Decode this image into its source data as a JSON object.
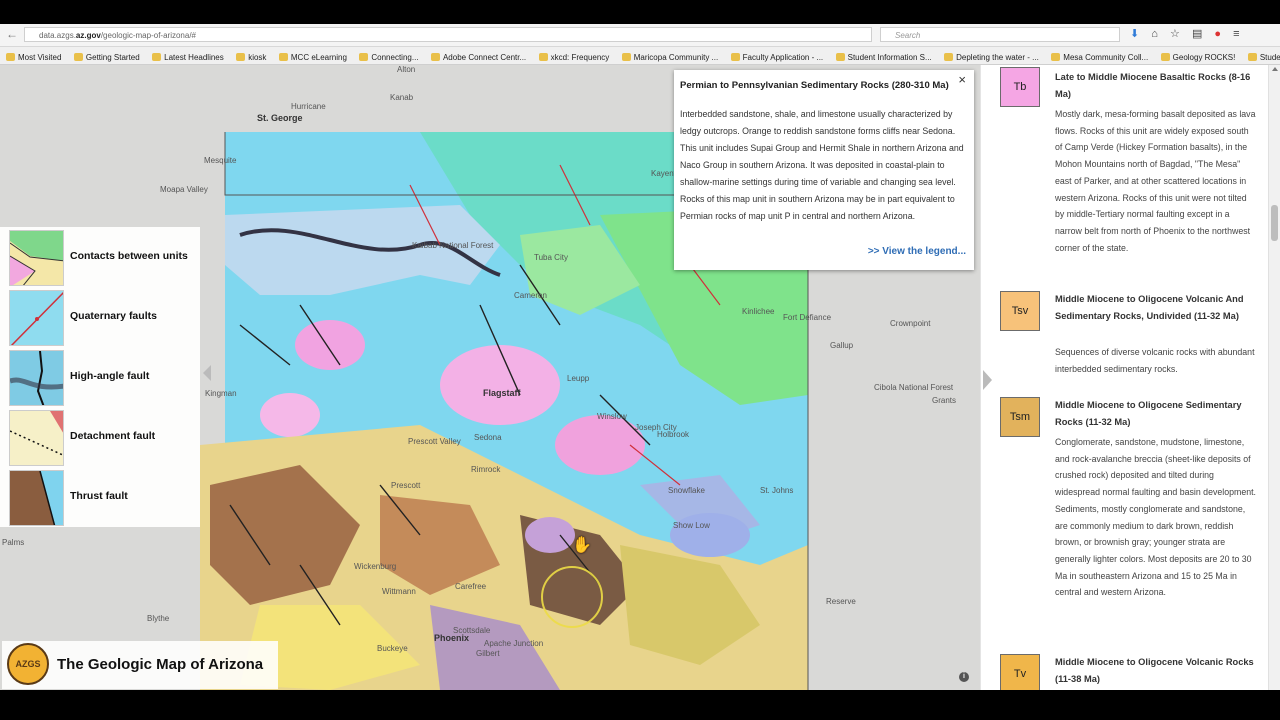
{
  "browser": {
    "url_prefix": "data.azgs.",
    "url_host": "az.gov",
    "url_path": "/geologic-map-of-arizona/#",
    "search_placeholder": "Search",
    "toolbar_icons": [
      "download-icon",
      "home-icon",
      "star-icon",
      "menu-icon",
      "profile-icon",
      "hamburger-icon"
    ]
  },
  "bookmarks": [
    "Most Visited",
    "Getting Started",
    "Latest Headlines",
    "kiosk",
    "MCC eLearning",
    "Connecting...",
    "Adobe Connect Centr...",
    "xkcd: Frequency",
    "Maricopa Community ...",
    "Faculty Application - ...",
    "Student Information S...",
    "Depleting the water - ...",
    "Mesa Community Coll...",
    "Geology ROCKS!",
    "Student Information S..."
  ],
  "legend": {
    "items": [
      {
        "label": "Contacts between units"
      },
      {
        "label": "Quaternary faults"
      },
      {
        "label": "High-angle fault"
      },
      {
        "label": "Detachment fault"
      },
      {
        "label": "Thrust fault"
      }
    ]
  },
  "popup": {
    "title": "Permian to Pennsylvanian Sedimentary Rocks (280-310 Ma)",
    "close": "×",
    "body": "Interbedded sandstone, shale, and limestone usually characterized by ledgy outcrops. Orange to reddish sandstone forms cliffs near Sedona. This unit includes Supai Group and Hermit Shale in northern Arizona and Naco Group in southern Arizona. It was deposited in coastal-plain to shallow-marine settings during time of variable and changing sea level. Rocks of this map unit in southern Arizona may be in part equivalent to Permian rocks of map unit P in central and northern Arizona.",
    "link": ">> View the legend..."
  },
  "map": {
    "title": "The Geologic Map of Arizona",
    "logo_text": "AZGS",
    "info": "i",
    "places": [
      "Alton",
      "St. George",
      "Kanab",
      "Hurricane",
      "Mesquite",
      "Moapa Valley",
      "Tuba City",
      "Cameron",
      "Kayenta",
      "Kinlichee",
      "Fort Defiance",
      "Crownpoint",
      "Gallup",
      "Leupp",
      "Winslow",
      "Flagstaff",
      "Sedona",
      "Joseph City",
      "Holbrook",
      "Cibola National Forest",
      "Grants",
      "Rimrock",
      "Prescott Valley",
      "Prescott",
      "Snowflake",
      "St. Johns",
      "Show Low",
      "Palms",
      "Wickenburg",
      "Wittmann",
      "Carefree",
      "Blythe",
      "Buckeye",
      "Phoenix",
      "Scottsdale",
      "Apache Junction",
      "Gilbert",
      "Reserve",
      "Kingman",
      "Kaibab National Forest"
    ]
  },
  "units": [
    {
      "code": "Tb",
      "color": "#f5a6e4",
      "name": "Late to Middle Miocene Basaltic Rocks (8-16 Ma)",
      "desc": "Mostly dark, mesa-forming basalt deposited as lava flows. Rocks of this unit are widely exposed south of Camp Verde (Hickey Formation basalts), in the Mohon Mountains north of Bagdad, \"The Mesa\" east of Parker, and at other scattered locations in western Arizona. Rocks of this unit were not tilted by middle-Tertiary normal faulting except in a narrow belt from north of Phoenix to the northwest corner of the state."
    },
    {
      "code": "Tsv",
      "color": "#f7c27a",
      "name": "Middle Miocene to Oligocene Volcanic And Sedimentary Rocks, Undivided (11-32 Ma)",
      "desc": "Sequences of diverse volcanic rocks with abundant interbedded sedimentary rocks."
    },
    {
      "code": "Tsm",
      "color": "#e2b25c",
      "name": "Middle Miocene to Oligocene Sedimentary Rocks (11-32 Ma)",
      "desc": "Conglomerate, sandstone, mudstone, limestone, and rock-avalanche breccia (sheet-like deposits of crushed rock) deposited and tilted during widespread normal faulting and basin development. Sediments, mostly conglomerate and sandstone, are commonly medium to dark brown, reddish brown, or brownish gray; younger strata are generally lighter colors. Most deposits are 20 to 30 Ma in southeastern Arizona and 15 to 25 Ma in central and western Arizona."
    },
    {
      "code": "Tv",
      "color": "#f0b64a",
      "name": "Middle Miocene to Oligocene Volcanic Rocks (11-38 Ma)",
      "desc": ""
    }
  ]
}
